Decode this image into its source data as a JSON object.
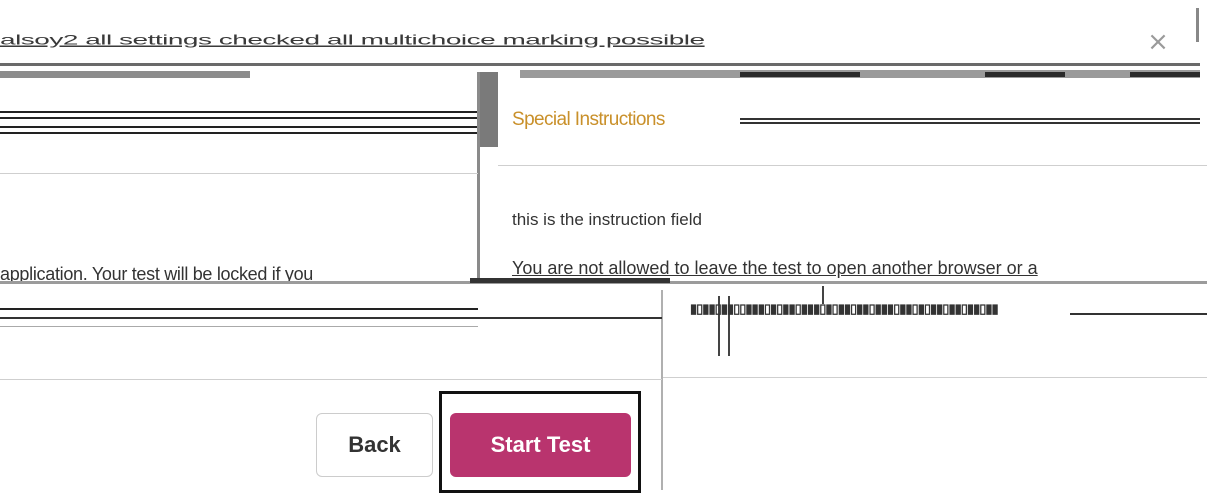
{
  "dialog": {
    "title": "alsoy2 all settings checked all multichoice marking possible",
    "close_glyph": "×"
  },
  "special_instructions": {
    "heading": "Special Instructions",
    "instruction_text": "this is the instruction field",
    "warning_right": "You are not allowed to leave the test to open another browser or a",
    "warning_left": "application. Your test will be locked if you"
  },
  "buttons": {
    "back_label": "Back",
    "start_label": "Start Test"
  },
  "colors": {
    "start_button": "#b9346e",
    "heading_accent": "#c9902a"
  }
}
